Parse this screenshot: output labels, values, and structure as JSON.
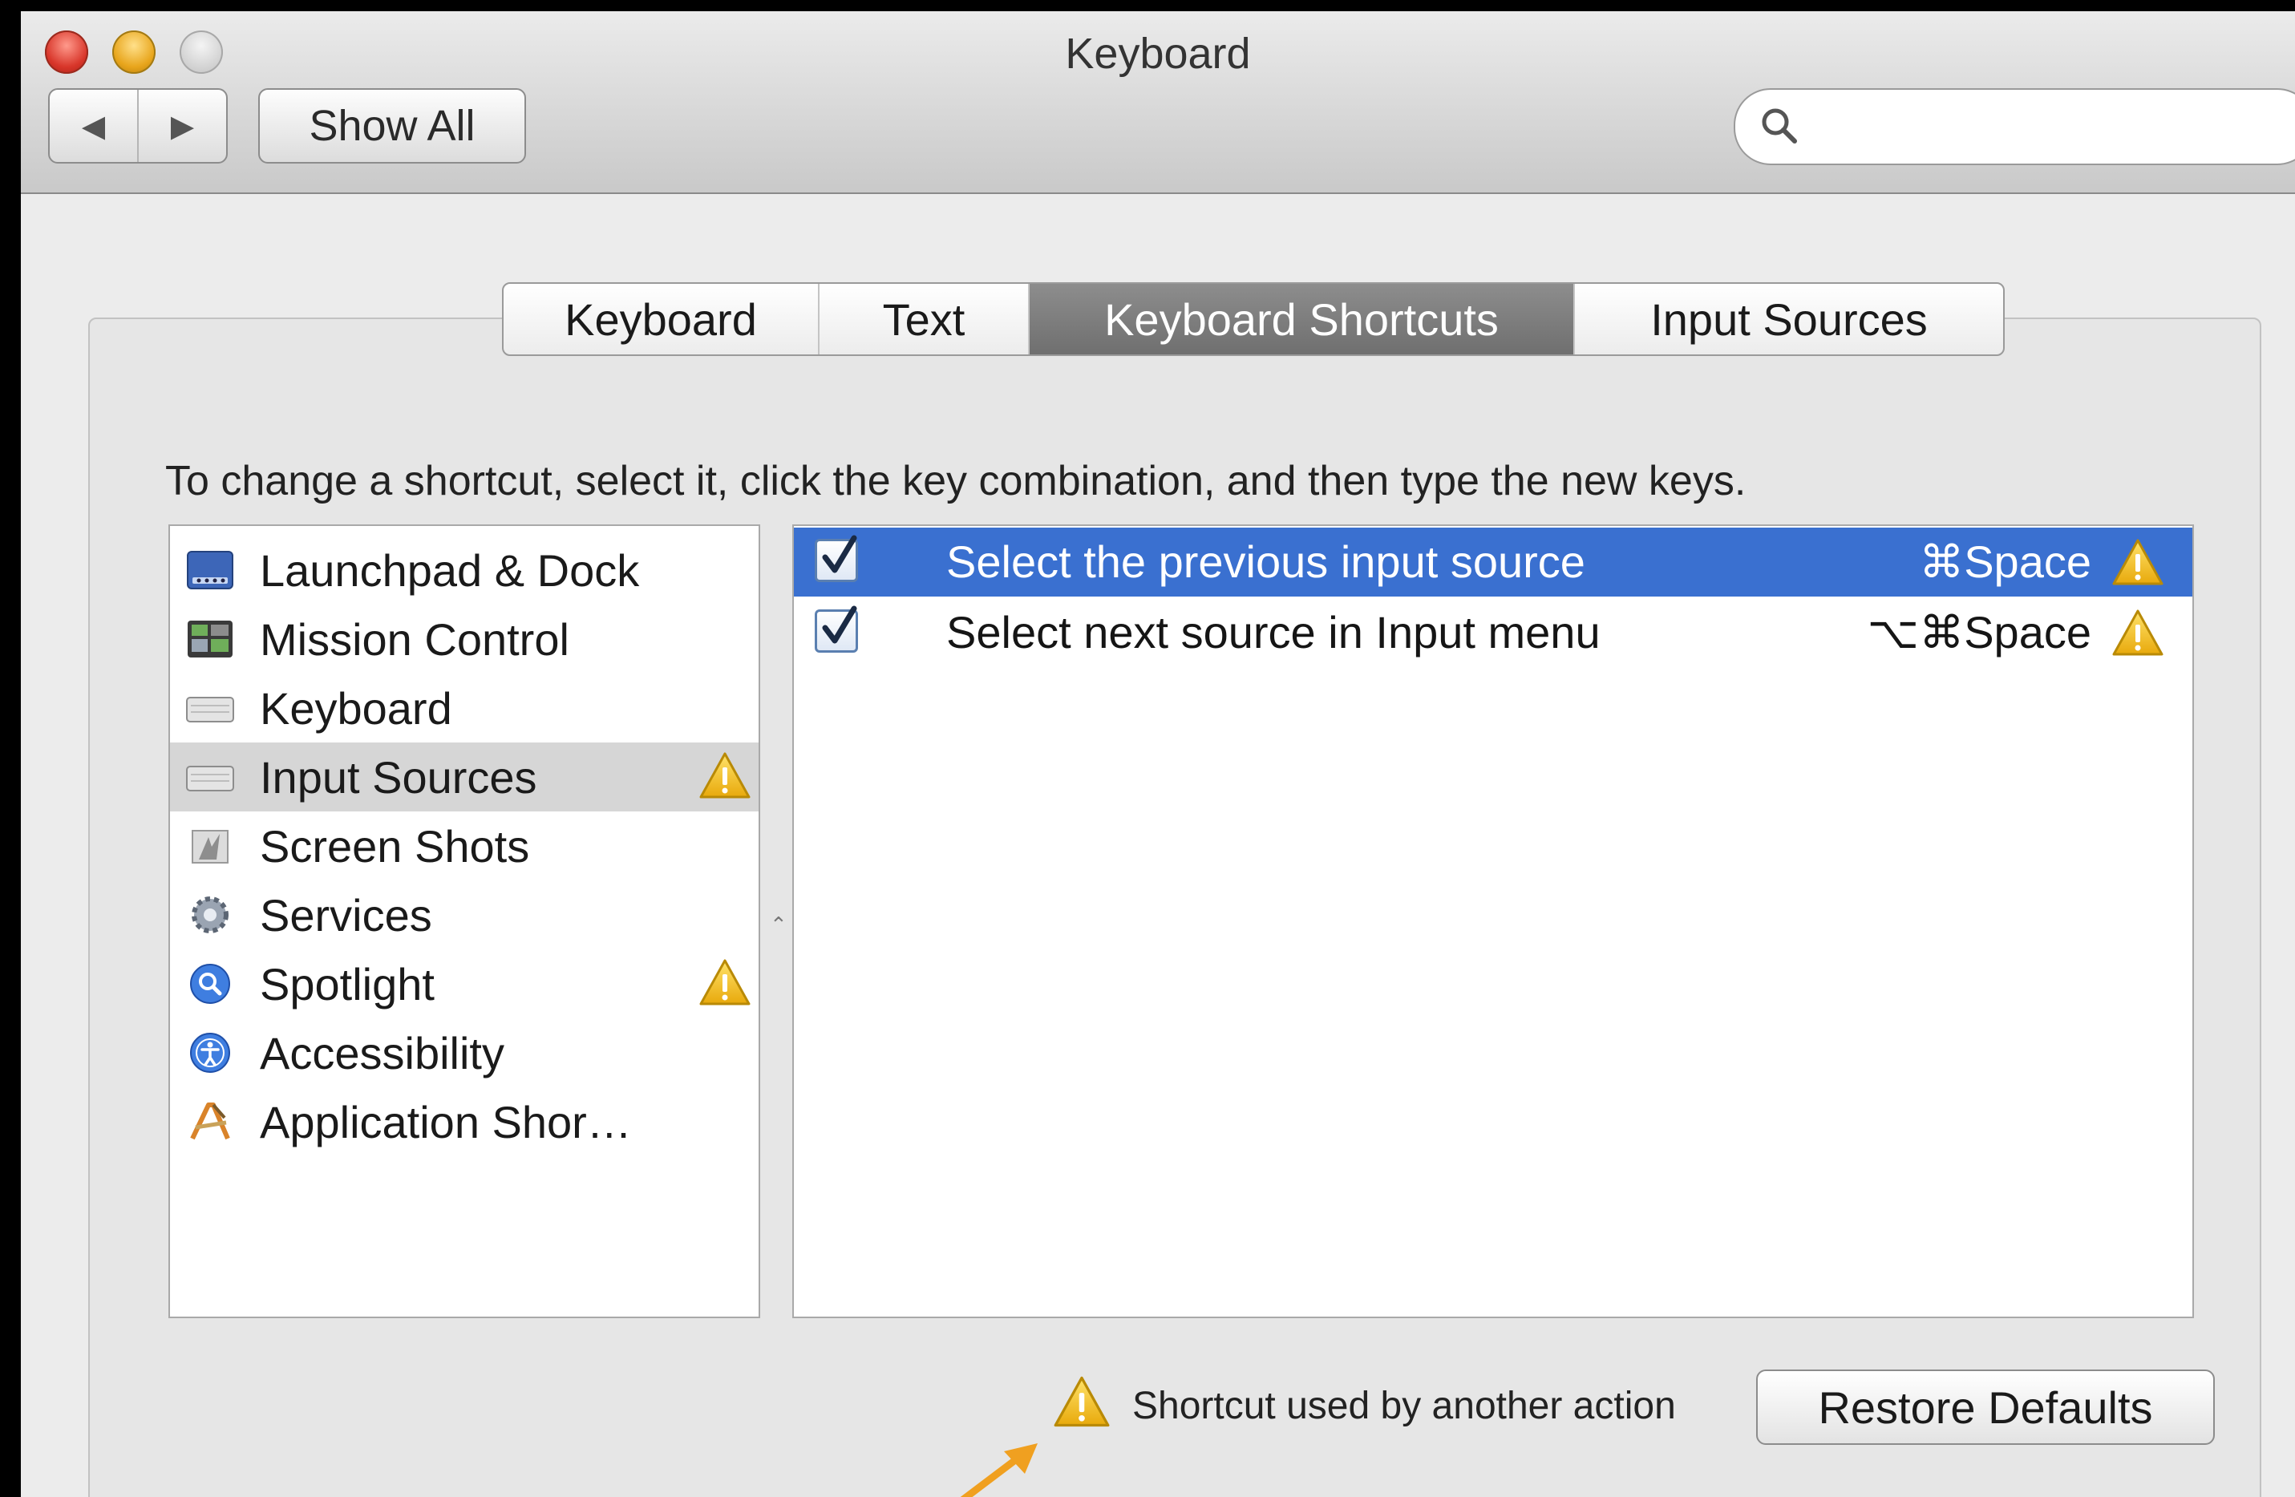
{
  "window": {
    "title": "Keyboard"
  },
  "toolbar": {
    "back_icon": "◀",
    "forward_icon": "▶",
    "show_all_label": "Show All",
    "search": {
      "value": "",
      "placeholder": ""
    }
  },
  "tabs": [
    {
      "label": "Keyboard",
      "active": false
    },
    {
      "label": "Text",
      "active": false
    },
    {
      "label": "Keyboard Shortcuts",
      "active": true
    },
    {
      "label": "Input Sources",
      "active": false
    }
  ],
  "instructions": "To change a shortcut, select it, click the key combination, and then type the new keys.",
  "categories": [
    {
      "label": "Launchpad & Dock",
      "icon": "launchpad-dock-icon",
      "warning": false,
      "selected": false
    },
    {
      "label": "Mission Control",
      "icon": "mission-control-icon",
      "warning": false,
      "selected": false
    },
    {
      "label": "Keyboard",
      "icon": "keyboard-icon",
      "warning": false,
      "selected": false
    },
    {
      "label": "Input Sources",
      "icon": "input-sources-icon",
      "warning": true,
      "selected": true
    },
    {
      "label": "Screen Shots",
      "icon": "screen-shots-icon",
      "warning": false,
      "selected": false
    },
    {
      "label": "Services",
      "icon": "services-gear-icon",
      "warning": false,
      "selected": false
    },
    {
      "label": "Spotlight",
      "icon": "spotlight-icon",
      "warning": true,
      "selected": false
    },
    {
      "label": "Accessibility",
      "icon": "accessibility-icon",
      "warning": false,
      "selected": false
    },
    {
      "label": "Application Shor…",
      "icon": "app-shortcuts-icon",
      "warning": false,
      "selected": false
    }
  ],
  "shortcuts": [
    {
      "checked": true,
      "label": "Select the previous input source",
      "keys": "⌘Space",
      "warning": true,
      "selected": true
    },
    {
      "checked": true,
      "label": "Select next source in Input menu",
      "keys": "⌥⌘Space",
      "warning": true,
      "selected": false
    }
  ],
  "legend": {
    "text": "Shortcut used by another action",
    "icon": "warning-icon"
  },
  "restore_defaults_label": "Restore Defaults",
  "colors": {
    "selection_blue": "#3a70d0",
    "warning_yellow": "#f5c518",
    "annotation_arrow": "#f0a020"
  }
}
